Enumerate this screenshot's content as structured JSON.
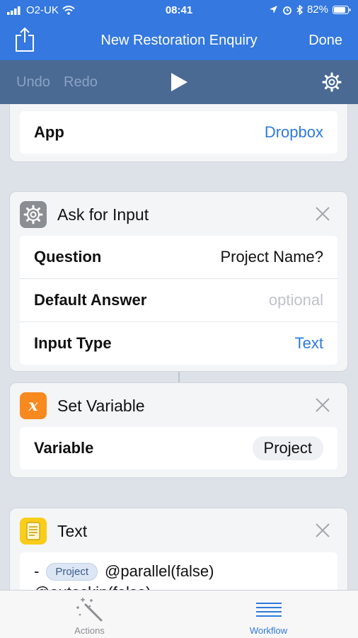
{
  "status": {
    "carrier": "O2-UK",
    "time": "08:41",
    "battery": "82%"
  },
  "nav": {
    "title": "New Restoration Enquiry",
    "done": "Done"
  },
  "toolbar": {
    "undo": "Undo",
    "redo": "Redo"
  },
  "dropbox_card": {
    "row_label": "App",
    "row_value": "Dropbox"
  },
  "ask_card": {
    "title": "Ask for Input",
    "rows": [
      {
        "label": "Question",
        "value": "Project Name?"
      },
      {
        "label": "Default Answer",
        "placeholder": "optional"
      },
      {
        "label": "Input Type",
        "value": "Text"
      }
    ]
  },
  "setvar_card": {
    "title": "Set Variable",
    "row_label": "Variable",
    "row_value": "Project"
  },
  "text_card": {
    "title": "Text",
    "dash": "-",
    "token": "Project",
    "line1": "@parallel(false)",
    "line2": "@autoskip(false)"
  },
  "tabs": {
    "actions": "Actions",
    "workflow": "Workflow"
  },
  "colors": {
    "accent": "#3478e0",
    "toolbar": "#4a6a94",
    "link": "#2e7adf",
    "variable_icon": "#f7891f",
    "text_icon": "#f9cd19"
  }
}
